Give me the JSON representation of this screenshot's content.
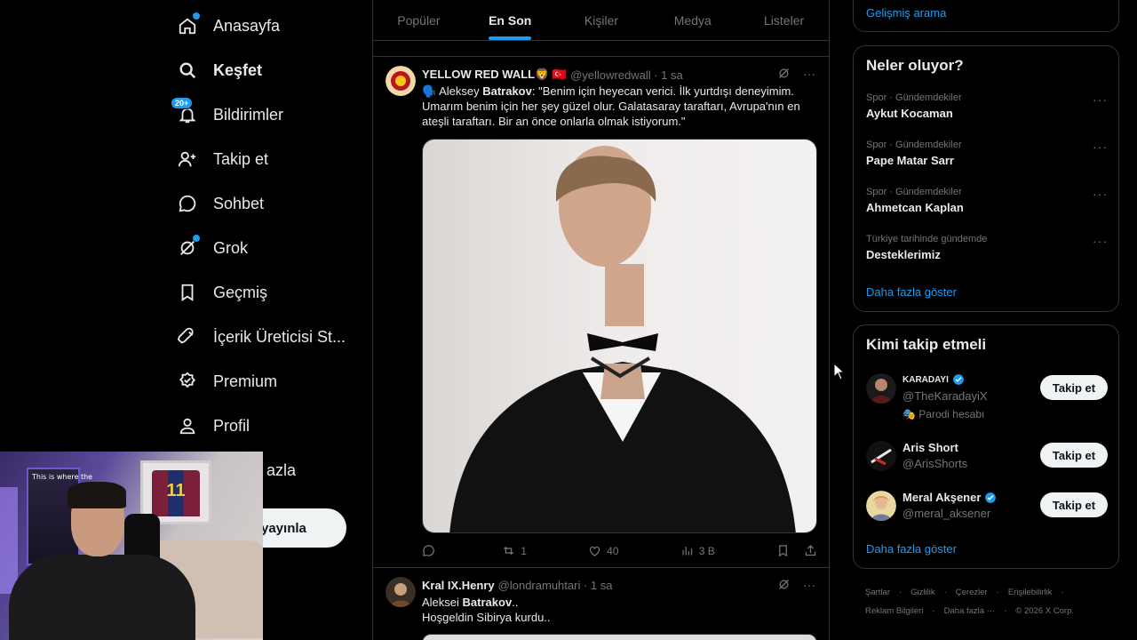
{
  "nav": {
    "items": [
      {
        "label": "Anasayfa",
        "icon": "home-icon"
      },
      {
        "label": "Keşfet",
        "icon": "search-icon"
      },
      {
        "label": "Bildirimler",
        "icon": "bell-icon",
        "badge": "20+"
      },
      {
        "label": "Takip et",
        "icon": "person-add-icon"
      },
      {
        "label": "Sohbet",
        "icon": "chat-icon"
      },
      {
        "label": "Grok",
        "icon": "grok-icon"
      },
      {
        "label": "Geçmiş",
        "icon": "bookmark-icon"
      },
      {
        "label": "İçerik Üreticisi St...",
        "icon": "rocket-icon"
      },
      {
        "label": "Premium",
        "icon": "premium-icon"
      },
      {
        "label": "Profil",
        "icon": "profile-icon"
      },
      {
        "label": "azla",
        "icon": "more-icon"
      }
    ],
    "post_button": "yayınla"
  },
  "webcam": {
    "sign": "This is where the",
    "jersey_number": "11"
  },
  "tabs": [
    "Popüler",
    "En Son",
    "Kişiler",
    "Medya",
    "Listeler"
  ],
  "active_tab": "En Son",
  "tweets": [
    {
      "name": "YELLOW RED WALL🦁 🇹🇷",
      "handle": "@yellowredwall · 1 sa",
      "text_lead": "🗣️ Aleksey ",
      "text_bold": "Batrakov",
      "text_rest": ": \"Benim için heyecan verici. İlk yurtdışı deneyimim. Umarım benim için her şey güzel olur. Galatasaray taraftarı, Avrupa'nın en ateşli taraftarı. Bir an önce onlarla olmak istiyorum.\"",
      "replies": "",
      "retweets": "1",
      "likes": "40",
      "views": "3 B"
    },
    {
      "name": "Kral IX.Henry",
      "handle": "@londramuhtari · 1 sa",
      "line1_lead": "Aleksei ",
      "line1_bold": "Batrakov",
      "line1_rest": "..",
      "line2": "Hoşgeldin Sibirya kurdu.."
    }
  ],
  "right": {
    "advanced_search": "Gelişmiş arama",
    "trends_title": "Neler oluyor?",
    "trends": [
      {
        "meta": "Spor · Gündemdekiler",
        "name": "Aykut Kocaman"
      },
      {
        "meta": "Spor · Gündemdekiler",
        "name": "Pape Matar Sarr"
      },
      {
        "meta": "Spor · Gündemdekiler",
        "name": "Ahmetcan Kaplan"
      },
      {
        "meta": "Türkiye tarihinde gündemde",
        "name": "Desteklerimiz"
      }
    ],
    "show_more": "Daha fazla göster",
    "who_title": "Kimi takip etmeli",
    "who": [
      {
        "name": "KARADAYI",
        "handle": "@TheKaradayiX",
        "parody": "🎭 Parodi hesabı",
        "verified": true
      },
      {
        "name": "Aris Short",
        "handle": "@ArisShorts",
        "verified": false
      },
      {
        "name": "Meral Akşener",
        "handle": "@meral_aksener",
        "verified": true
      }
    ],
    "follow_label": "Takip et",
    "who_show_more": "Daha fazla göster"
  },
  "footer": {
    "row1": [
      "Şartlar",
      "·",
      "Gizlilik",
      "·",
      "Çerezler",
      "·",
      "Erişilebilirlik",
      "·"
    ],
    "row2": [
      "Reklam Bilgileri",
      "·",
      "Daha fazla ···",
      "·",
      "© 2026 X Corp."
    ]
  },
  "colors": {
    "accent": "#1d9bf0",
    "background": "#000000",
    "border": "#2f3336",
    "muted": "#71767b"
  }
}
